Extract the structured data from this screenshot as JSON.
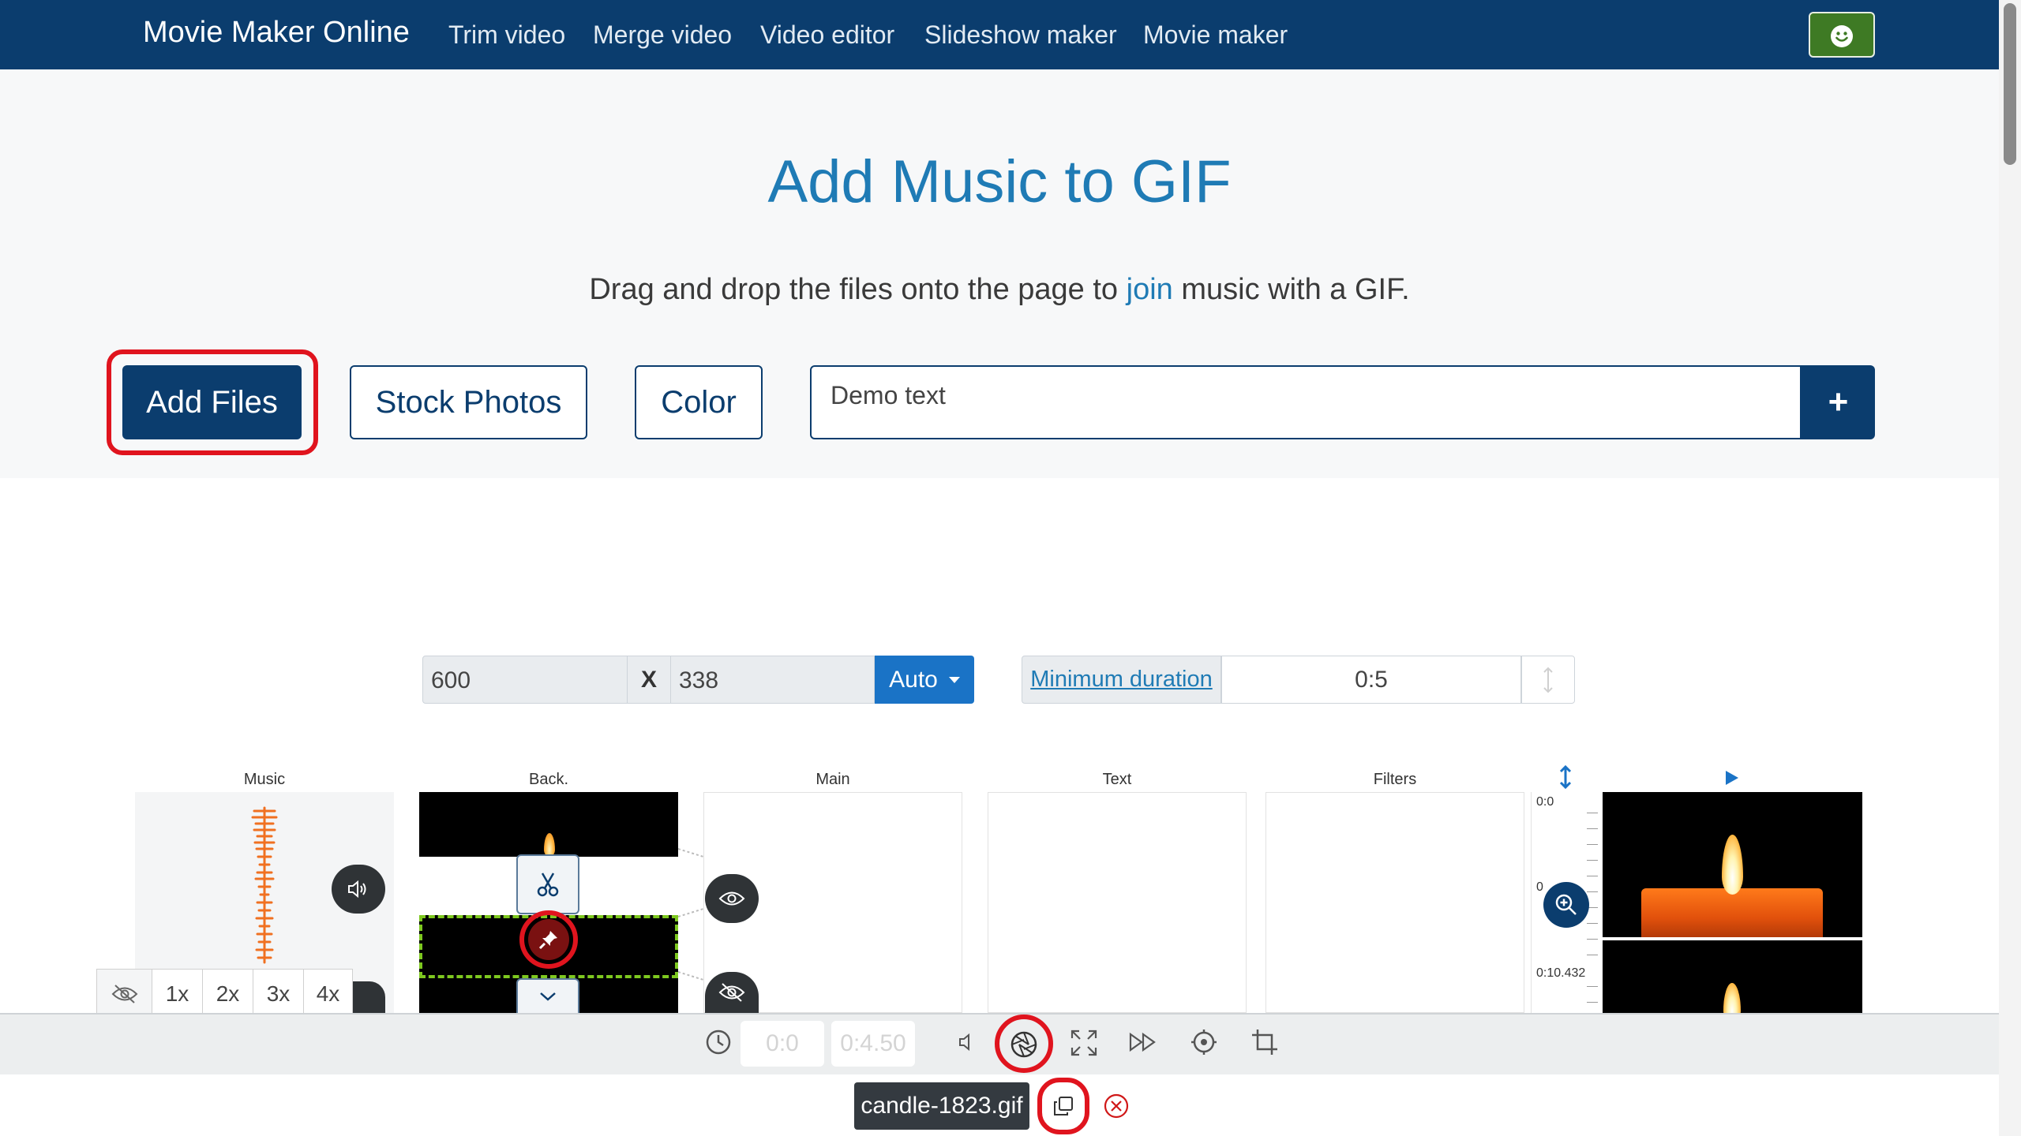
{
  "navbar": {
    "brand": "Movie Maker Online",
    "links": [
      "Trim video",
      "Merge video",
      "Video editor",
      "Slideshow maker",
      "Movie maker"
    ],
    "user_icon": "smiley-icon"
  },
  "hero": {
    "title": "Add Music to GIF",
    "subtitle_before": "Drag and drop the files onto the page to ",
    "subtitle_link": "join",
    "subtitle_after": " music with a GIF."
  },
  "actions": {
    "add_files": "Add Files",
    "stock_photos": "Stock Photos",
    "color": "Color",
    "text_value": "Demo text",
    "add_text": "+"
  },
  "size": {
    "width": "600",
    "separator": "X",
    "height": "338",
    "mode": "Auto"
  },
  "duration": {
    "label": "Minimum duration",
    "value": "0:5"
  },
  "columns": {
    "music": "Music",
    "back": "Back.",
    "main": "Main",
    "text": "Text",
    "filters": "Filters"
  },
  "ruler": {
    "start": "0:0",
    "mid": "0",
    "end": "0:10.432"
  },
  "speed": [
    "1x",
    "2x",
    "3x",
    "4x"
  ],
  "player": {
    "current_time": "0:0",
    "end_time": "0:4.50"
  },
  "file": {
    "name": "candle-1823.gif"
  },
  "colors": {
    "navbar": "#0b3d6e",
    "title": "#1f7bb5",
    "accent_blue": "#1a73c6",
    "highlight_red": "#e0141e",
    "waveform": "#f07020",
    "selection_green": "#7ec820"
  }
}
